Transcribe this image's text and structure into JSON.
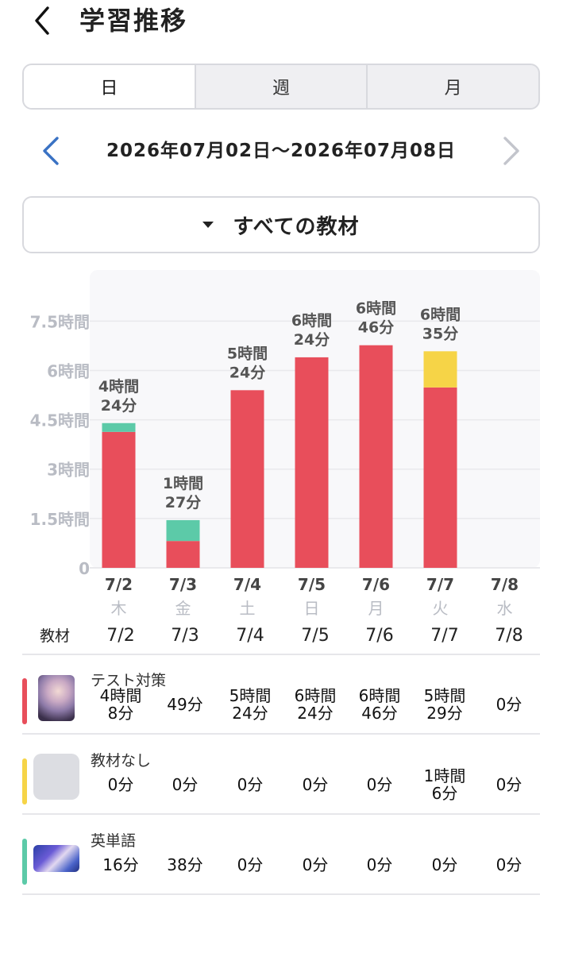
{
  "header": {
    "title": "学習推移"
  },
  "tabs": [
    "日",
    "週",
    "月"
  ],
  "date_range": "2026年07月02日〜2026年07月08日",
  "material_filter": {
    "label": "すべての教材"
  },
  "colors": {
    "test": "#e84e5b",
    "none": "#f6d447",
    "vocab": "#5ccaa8",
    "axis_text": "#b9bcc4",
    "grid": "#e9e9ec"
  },
  "chart_data": {
    "type": "bar",
    "stacked": true,
    "categories": [
      "7/2",
      "7/3",
      "7/4",
      "7/5",
      "7/6",
      "7/7",
      "7/8"
    ],
    "weekdays": [
      "木",
      "金",
      "土",
      "日",
      "月",
      "火",
      "水"
    ],
    "yticks": [
      "0",
      "1.5時間",
      "3時間",
      "4.5時間",
      "6時間",
      "7.5時間"
    ],
    "ylim": [
      0,
      9
    ],
    "series": [
      {
        "name": "テスト対策",
        "color": "#e84e5b",
        "values_min": [
          248,
          49,
          324,
          384,
          406,
          329,
          0
        ]
      },
      {
        "name": "教材なし",
        "color": "#f6d447",
        "values_min": [
          0,
          0,
          0,
          0,
          0,
          66,
          0
        ]
      },
      {
        "name": "英単語",
        "color": "#5ccaa8",
        "values_min": [
          16,
          38,
          0,
          0,
          0,
          0,
          0
        ]
      }
    ],
    "totals": [
      [
        "4時間",
        "24分"
      ],
      [
        "1時間",
        "27分"
      ],
      [
        "5時間",
        "24分"
      ],
      [
        "6時間",
        "24分"
      ],
      [
        "6時間",
        "46分"
      ],
      [
        "6時間",
        "35分"
      ],
      null
    ]
  },
  "table": {
    "label": "教材",
    "dates": [
      "7/2",
      "7/3",
      "7/4",
      "7/5",
      "7/6",
      "7/7",
      "7/8"
    ],
    "rows": [
      {
        "name": "テスト対策",
        "color": "#e84e5b",
        "thumb": "photo",
        "cells": [
          [
            "4時間",
            "8分"
          ],
          [
            "49分"
          ],
          [
            "5時間",
            "24分"
          ],
          [
            "6時間",
            "24分"
          ],
          [
            "6時間",
            "46分"
          ],
          [
            "5時間",
            "29分"
          ],
          [
            "0分"
          ]
        ]
      },
      {
        "name": "教材なし",
        "color": "#f6d447",
        "thumb": "blank",
        "cells": [
          [
            "0分"
          ],
          [
            "0分"
          ],
          [
            "0分"
          ],
          [
            "0分"
          ],
          [
            "0分"
          ],
          [
            "1時間",
            "6分"
          ],
          [
            "0分"
          ]
        ]
      },
      {
        "name": "英単語",
        "color": "#5ccaa8",
        "thumb": "wide",
        "cells": [
          [
            "16分"
          ],
          [
            "38分"
          ],
          [
            "0分"
          ],
          [
            "0分"
          ],
          [
            "0分"
          ],
          [
            "0分"
          ],
          [
            "0分"
          ]
        ]
      }
    ]
  }
}
